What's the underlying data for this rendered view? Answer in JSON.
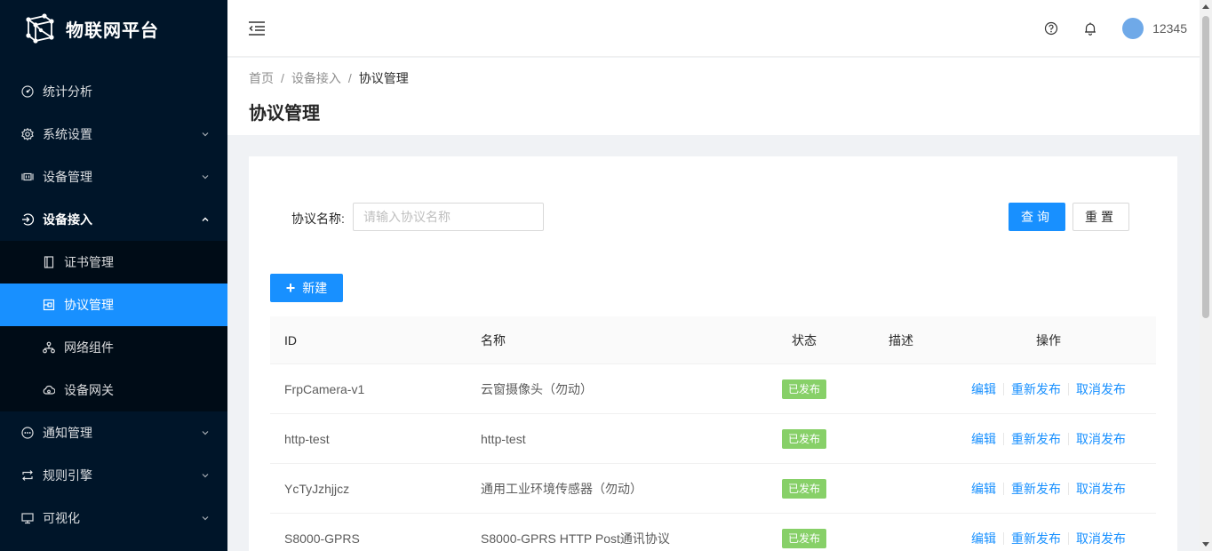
{
  "app": {
    "title": "物联网平台"
  },
  "sidebar": {
    "items": [
      {
        "label": "统计分析",
        "icon": "dashboard-icon",
        "has_arrow": false
      },
      {
        "label": "系统设置",
        "icon": "gear-icon",
        "has_arrow": true
      },
      {
        "label": "设备管理",
        "icon": "device-icon",
        "has_arrow": true
      },
      {
        "label": "设备接入",
        "icon": "login-icon",
        "has_arrow": true,
        "open": true,
        "children": [
          {
            "label": "证书管理",
            "icon": "file-icon"
          },
          {
            "label": "协议管理",
            "icon": "protocol-icon",
            "active": true
          },
          {
            "label": "网络组件",
            "icon": "network-icon"
          },
          {
            "label": "设备网关",
            "icon": "cloud-icon"
          }
        ]
      },
      {
        "label": "通知管理",
        "icon": "message-icon",
        "has_arrow": true
      },
      {
        "label": "规则引擎",
        "icon": "swap-icon",
        "has_arrow": true
      },
      {
        "label": "可视化",
        "icon": "desktop-icon",
        "has_arrow": true
      }
    ]
  },
  "header": {
    "username": "12345"
  },
  "breadcrumb": [
    "首页",
    "设备接入",
    "协议管理"
  ],
  "page": {
    "title": "协议管理"
  },
  "search": {
    "label": "协议名称:",
    "placeholder": "请输入协议名称",
    "value": ""
  },
  "buttons": {
    "query": "查询",
    "reset": "重置",
    "new": "新建"
  },
  "table": {
    "columns": [
      "ID",
      "名称",
      "状态",
      "描述",
      "操作"
    ],
    "rows": [
      {
        "id": "FrpCamera-v1",
        "name": "云窗摄像头（勿动）",
        "status": "已发布",
        "desc": ""
      },
      {
        "id": "http-test",
        "name": "http-test",
        "status": "已发布",
        "desc": ""
      },
      {
        "id": "YcTyJzhjjcz",
        "name": "通用工业环境传感器（勿动）",
        "status": "已发布",
        "desc": ""
      },
      {
        "id": "S8000-GPRS",
        "name": "S8000-GPRS HTTP Post通讯协议",
        "status": "已发布",
        "desc": ""
      }
    ],
    "actions": [
      "编辑",
      "重新发布",
      "取消发布"
    ]
  },
  "colors": {
    "sidebar_bg": "#001529",
    "submenu_bg": "#000c17",
    "primary": "#1890ff",
    "tag_success": "#87d068"
  }
}
